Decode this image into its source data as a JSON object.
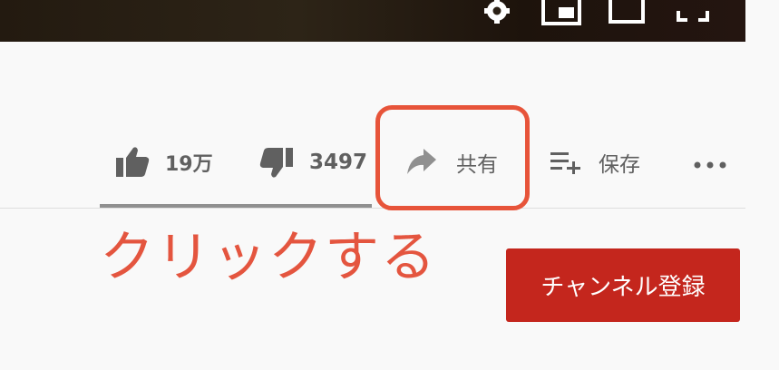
{
  "player": {
    "controls": [
      {
        "name": "settings-icon"
      },
      {
        "name": "miniplayer-icon"
      },
      {
        "name": "theater-mode-icon"
      },
      {
        "name": "fullscreen-icon"
      }
    ]
  },
  "actions": {
    "like": {
      "count": "19万",
      "icon": "thumbs-up-icon"
    },
    "dislike": {
      "count": "3497",
      "icon": "thumbs-down-icon"
    },
    "share": {
      "label": "共有",
      "icon": "share-arrow-icon"
    },
    "save": {
      "label": "保存",
      "icon": "playlist-add-icon"
    },
    "more": {
      "icon": "more-dots-icon"
    }
  },
  "annotation": {
    "text": "クリックする",
    "color": "#e4553f"
  },
  "subscribe": {
    "label": "チャンネル登録",
    "color": "#c4261d"
  },
  "colors": {
    "highlight": "#e7543a",
    "icon": "#606060",
    "background": "#f9f9f9"
  }
}
